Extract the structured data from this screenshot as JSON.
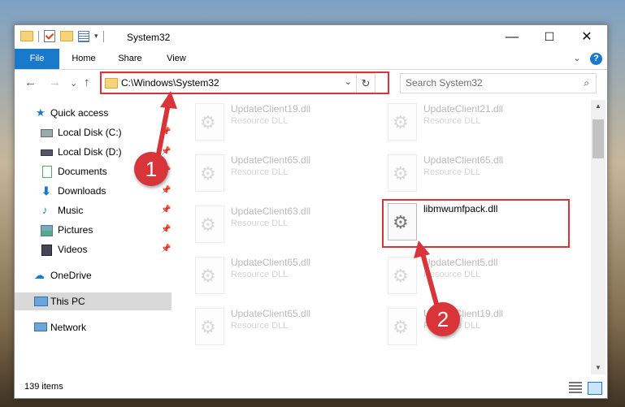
{
  "window": {
    "title": "System32"
  },
  "title_controls": {
    "minimize": "—",
    "maximize": "☐",
    "close": "✕"
  },
  "ribbon": {
    "tabs": [
      "File",
      "Home",
      "Share",
      "View"
    ],
    "expand": "⌄",
    "help": "?"
  },
  "nav": {
    "back": "←",
    "forward": "→",
    "recent": "⌄",
    "up": "↑"
  },
  "address": {
    "path": "C:\\Windows\\System32",
    "dropdown": "⌄",
    "refresh": "↻"
  },
  "search": {
    "placeholder": "Search System32",
    "icon": "⌕"
  },
  "sidebar": {
    "items": [
      {
        "label": "Quick access",
        "icon": "star-icon"
      },
      {
        "label": "Local Disk (C:)",
        "icon": "drive-icon",
        "pinned": true
      },
      {
        "label": "Local Disk (D:)",
        "icon": "drive-icon",
        "pinned": true
      },
      {
        "label": "Documents",
        "icon": "documents-icon",
        "pinned": true
      },
      {
        "label": "Downloads",
        "icon": "download-icon",
        "pinned": true
      },
      {
        "label": "Music",
        "icon": "music-icon",
        "pinned": true
      },
      {
        "label": "Pictures",
        "icon": "pictures-icon",
        "pinned": true
      },
      {
        "label": "Videos",
        "icon": "videos-icon",
        "pinned": true
      },
      {
        "label": "OneDrive",
        "icon": "cloud-icon"
      },
      {
        "label": "This PC",
        "icon": "computer-icon",
        "selected": true
      },
      {
        "label": "Network",
        "icon": "network-icon"
      }
    ],
    "pin_glyph": "📌"
  },
  "files": [
    {
      "name": "UpdateClient19.dll",
      "desc": "Resource DLL"
    },
    {
      "name": "UpdateClient21.dll",
      "desc": "Resource DLL"
    },
    {
      "name": "UpdateClient65.dll",
      "desc": "Resource DLL"
    },
    {
      "name": "UpdateClient65.dll",
      "desc": "Resource DLL"
    },
    {
      "name": "UpdateClient63.dll",
      "desc": "Resource DLL"
    },
    {
      "name": "libmwumfpack.dll",
      "desc": "",
      "highlighted": true
    },
    {
      "name": "UpdateClient65.dll",
      "desc": "Resource DLL"
    },
    {
      "name": "UpdateClient5.dll",
      "desc": "Resource DLL"
    },
    {
      "name": "UpdateClient65.dll",
      "desc": "Resource DLL"
    },
    {
      "name": "UpdateClient19.dll",
      "desc": "Resource DLL"
    }
  ],
  "status": {
    "count": "139 items"
  },
  "annotations": {
    "step1": "1",
    "step2": "2",
    "color": "#d8343a"
  },
  "colors": {
    "accent": "#1979ca",
    "selection": "#d9d9d9"
  }
}
